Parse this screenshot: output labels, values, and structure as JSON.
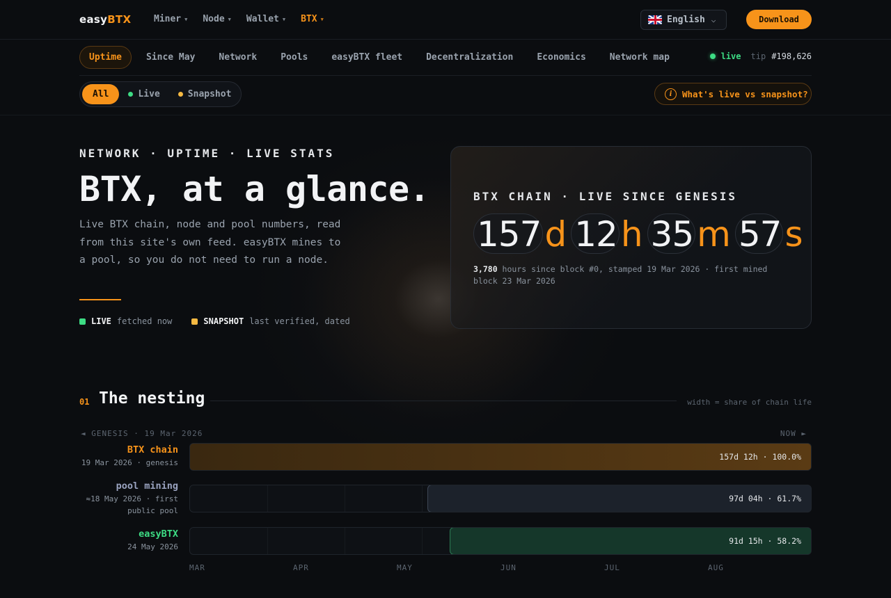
{
  "brand": {
    "name_a": "easy",
    "name_b": "BTX"
  },
  "menu": [
    {
      "label": "Miner",
      "active": false
    },
    {
      "label": "Node",
      "active": false
    },
    {
      "label": "Wallet",
      "active": false
    },
    {
      "label": "BTX",
      "active": true
    }
  ],
  "language": {
    "label": "English"
  },
  "download_label": "Download",
  "tabs": [
    {
      "label": "Uptime",
      "active": true
    },
    {
      "label": "Since May",
      "active": false
    },
    {
      "label": "Network",
      "active": false
    },
    {
      "label": "Pools",
      "active": false
    },
    {
      "label": "easyBTX fleet",
      "active": false
    },
    {
      "label": "Decentralization",
      "active": false
    },
    {
      "label": "Economics",
      "active": false
    },
    {
      "label": "Network map",
      "active": false
    }
  ],
  "status": {
    "live_label": "live",
    "tip_label": "tip",
    "tip_value": "#198,626"
  },
  "filters": [
    {
      "label": "All",
      "active": true,
      "dot": ""
    },
    {
      "label": "Live",
      "active": false,
      "dot": "#3ddc84"
    },
    {
      "label": "Snapshot",
      "active": false,
      "dot": "#f5b942"
    }
  ],
  "whats_live_label": "What's live vs snapshot?",
  "hero": {
    "eyebrow": "NETWORK · UPTIME · LIVE STATS",
    "title": "BTX, at a glance.",
    "description": "Live BTX chain, node and pool numbers, read from this site's own feed. easyBTX mines to a pool, so you do not need to run a node.",
    "legend": [
      {
        "label": "LIVE",
        "text": "fetched now",
        "color": "#3ddc84"
      },
      {
        "label": "SNAPSHOT",
        "text": "last verified, dated",
        "color": "#f5b942"
      }
    ]
  },
  "panel": {
    "eyebrow": "BTX CHAIN · LIVE SINCE GENESIS",
    "counter": [
      {
        "value": "157",
        "unit": "d"
      },
      {
        "value": "12",
        "unit": "h"
      },
      {
        "value": "35",
        "unit": "m"
      },
      {
        "value": "57",
        "unit": "s"
      }
    ],
    "note_bold": "3,780",
    "note_text": " hours since block #0, stamped 19 Mar 2026 · first mined block 23 Mar 2026"
  },
  "section": {
    "number": "01",
    "title": "The nesting",
    "note": "width = share of chain life",
    "axis_left": "◄ GENESIS · 19 Mar 2026",
    "axis_right": "NOW ►"
  },
  "timeline": [
    {
      "name": "BTX chain",
      "sub": "19 Mar 2026 · genesis",
      "value": "157d 12h · 100.0%",
      "share": 1.0,
      "color": "#f7931a",
      "kind": "chain"
    },
    {
      "name": "pool mining",
      "sub": "≈18 May 2026 · first public pool",
      "value": "97d 04h · 61.7%",
      "share": 0.617,
      "color": "#9aa3c0",
      "kind": "pool"
    },
    {
      "name": "easyBTX",
      "sub": "24 May 2026",
      "value": "91d 15h · 58.2%",
      "share": 0.582,
      "color": "#3ddc84",
      "kind": "easy"
    }
  ],
  "months": [
    "MAR",
    "APR",
    "MAY",
    "JUN",
    "JUL",
    "AUG"
  ],
  "colors": {
    "accent": "#f7931a",
    "live": "#3ddc84",
    "snapshot": "#f5b942",
    "background": "#0b0d10"
  }
}
